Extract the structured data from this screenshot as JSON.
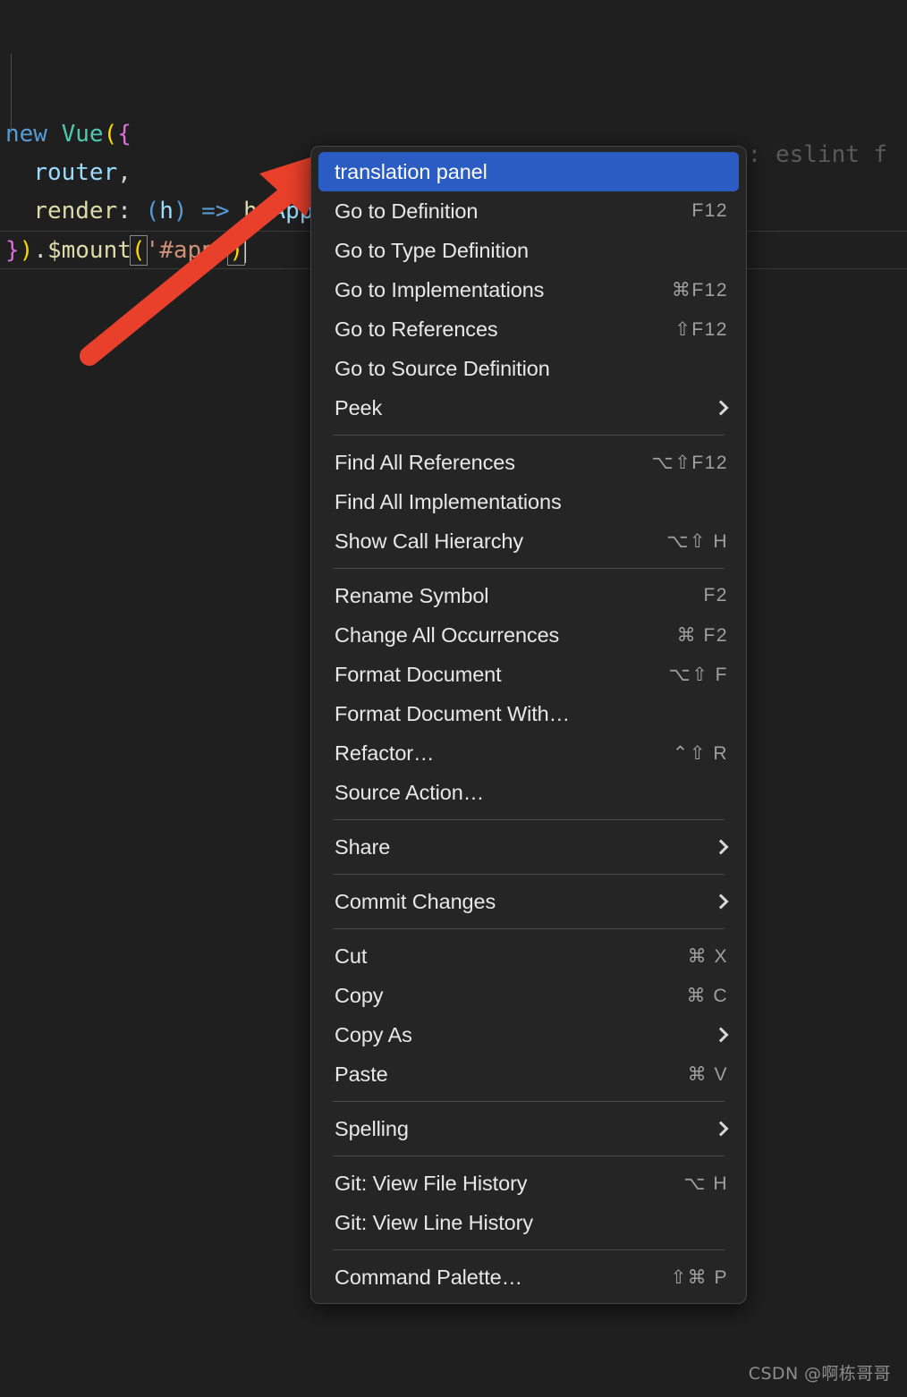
{
  "editor": {
    "code_lines": [
      {
        "tokens": [
          {
            "t": "new",
            "c": "kw"
          },
          {
            "t": " ",
            "c": "plain"
          },
          {
            "t": "Vue",
            "c": "type"
          },
          {
            "t": "(",
            "c": "paren-y"
          },
          {
            "t": "{",
            "c": "brace-m"
          }
        ]
      },
      {
        "tokens": [
          {
            "t": "  ",
            "c": "plain"
          },
          {
            "t": "router",
            "c": "var"
          },
          {
            "t": ",",
            "c": "plain"
          }
        ]
      },
      {
        "tokens": [
          {
            "t": "  ",
            "c": "plain"
          },
          {
            "t": "render",
            "c": "prop"
          },
          {
            "t": ": ",
            "c": "plain"
          },
          {
            "t": "(",
            "c": "arrow"
          },
          {
            "t": "h",
            "c": "var"
          },
          {
            "t": ")",
            "c": "arrow"
          },
          {
            "t": " ",
            "c": "plain"
          },
          {
            "t": "=>",
            "c": "arrow"
          },
          {
            "t": " ",
            "c": "plain"
          },
          {
            "t": "h",
            "c": "prop"
          },
          {
            "t": "(",
            "c": "arrow"
          },
          {
            "t": "App",
            "c": "var"
          },
          {
            "t": ")",
            "c": "arrow"
          },
          {
            "t": ",",
            "c": "plain"
          }
        ]
      },
      {
        "tokens": [
          {
            "t": "}",
            "c": "brace-m"
          },
          {
            "t": ")",
            "c": "paren-y"
          },
          {
            "t": ".",
            "c": "plain"
          },
          {
            "t": "$mount",
            "c": "prop"
          },
          {
            "t": "(",
            "c": "paren-y box"
          },
          {
            "t": "'#app'",
            "c": "str"
          },
          {
            "t": ")",
            "c": "paren-y box"
          }
        ]
      }
    ],
    "inline_hint": "e: eslint f"
  },
  "context_menu": {
    "groups": [
      {
        "items": [
          {
            "label": "translation panel",
            "accel": "",
            "submenu": false,
            "selected": true
          },
          {
            "label": "Go to Definition",
            "accel": "F12",
            "submenu": false,
            "selected": false
          },
          {
            "label": "Go to Type Definition",
            "accel": "",
            "submenu": false,
            "selected": false
          },
          {
            "label": "Go to Implementations",
            "accel": "⌘F12",
            "submenu": false,
            "selected": false
          },
          {
            "label": "Go to References",
            "accel": "⇧F12",
            "submenu": false,
            "selected": false
          },
          {
            "label": "Go to Source Definition",
            "accel": "",
            "submenu": false,
            "selected": false
          },
          {
            "label": "Peek",
            "accel": "",
            "submenu": true,
            "selected": false
          }
        ]
      },
      {
        "items": [
          {
            "label": "Find All References",
            "accel": "⌥⇧F12",
            "submenu": false,
            "selected": false
          },
          {
            "label": "Find All Implementations",
            "accel": "",
            "submenu": false,
            "selected": false
          },
          {
            "label": "Show Call Hierarchy",
            "accel": "⌥⇧ H",
            "submenu": false,
            "selected": false
          }
        ]
      },
      {
        "items": [
          {
            "label": "Rename Symbol",
            "accel": "F2",
            "submenu": false,
            "selected": false
          },
          {
            "label": "Change All Occurrences",
            "accel": "⌘ F2",
            "submenu": false,
            "selected": false
          },
          {
            "label": "Format Document",
            "accel": "⌥⇧ F",
            "submenu": false,
            "selected": false
          },
          {
            "label": "Format Document With…",
            "accel": "",
            "submenu": false,
            "selected": false
          },
          {
            "label": "Refactor…",
            "accel": "⌃⇧ R",
            "submenu": false,
            "selected": false
          },
          {
            "label": "Source Action…",
            "accel": "",
            "submenu": false,
            "selected": false
          }
        ]
      },
      {
        "items": [
          {
            "label": "Share",
            "accel": "",
            "submenu": true,
            "selected": false
          }
        ]
      },
      {
        "items": [
          {
            "label": "Commit Changes",
            "accel": "",
            "submenu": true,
            "selected": false
          }
        ]
      },
      {
        "items": [
          {
            "label": "Cut",
            "accel": "⌘ X",
            "submenu": false,
            "selected": false
          },
          {
            "label": "Copy",
            "accel": "⌘ C",
            "submenu": false,
            "selected": false
          },
          {
            "label": "Copy As",
            "accel": "",
            "submenu": true,
            "selected": false
          },
          {
            "label": "Paste",
            "accel": "⌘ V",
            "submenu": false,
            "selected": false
          }
        ]
      },
      {
        "items": [
          {
            "label": "Spelling",
            "accel": "",
            "submenu": true,
            "selected": false
          }
        ]
      },
      {
        "items": [
          {
            "label": "Git: View File History",
            "accel": "⌥ H",
            "submenu": false,
            "selected": false
          },
          {
            "label": "Git: View Line History",
            "accel": "",
            "submenu": false,
            "selected": false
          }
        ]
      },
      {
        "items": [
          {
            "label": "Command Palette…",
            "accel": "⇧⌘ P",
            "submenu": false,
            "selected": false
          }
        ]
      }
    ]
  },
  "annotation": {
    "arrow_color": "#e8402a"
  },
  "watermark": {
    "text": "CSDN @啊栋哥哥"
  },
  "colors": {
    "editor_bg": "#1f1f1f",
    "menu_bg": "#252526",
    "menu_border": "#454545",
    "selected_bg": "#2b5cc4",
    "accel_fg": "#a0a0a0",
    "label_fg": "#e8e8e8"
  }
}
